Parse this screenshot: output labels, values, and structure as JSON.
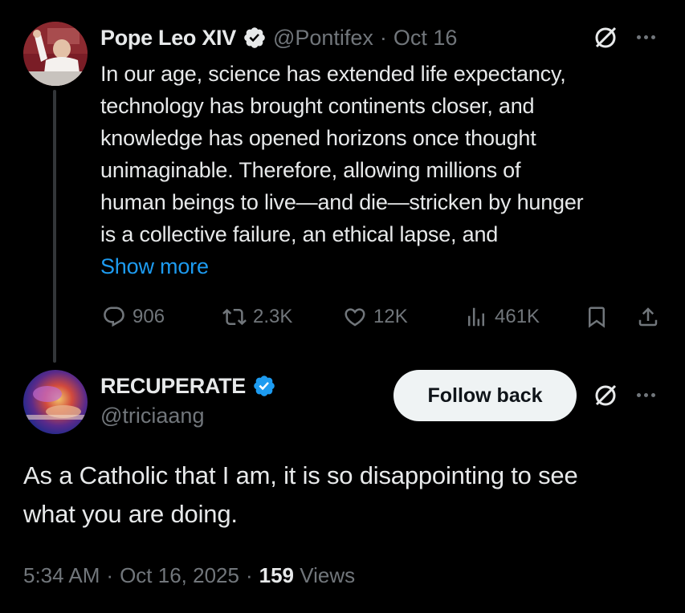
{
  "tweet": {
    "author_name": "Pope Leo XIV",
    "handle": "@Pontifex",
    "separator": "·",
    "date": "Oct 16",
    "text_lines": [
      "In our age, science has extended life expectancy,",
      "technology has brought continents closer, and",
      "knowledge has opened horizons once thought",
      "unimaginable. Therefore, allowing millions of",
      "human beings to live—and die—stricken by hunger",
      "is a collective failure, an ethical lapse, and"
    ],
    "show_more": "Show more",
    "stats": {
      "replies": "906",
      "reposts": "2.3K",
      "likes": "12K",
      "views": "461K"
    }
  },
  "reply": {
    "author_name": "RECUPERATE",
    "handle": "@triciaang",
    "follow_label": "Follow back",
    "text_lines": [
      "As a Catholic that I am, it is so disappointing to see",
      "what you are doing."
    ],
    "time": "5:34 AM",
    "separator": "·",
    "date": "Oct 16, 2025",
    "views_count": "159",
    "views_label": "Views"
  },
  "colors": {
    "background": "#000000",
    "verified": "#1d9bf0",
    "link": "#1d9bf0",
    "muted": "#71767b",
    "text": "#e7e9ea"
  }
}
